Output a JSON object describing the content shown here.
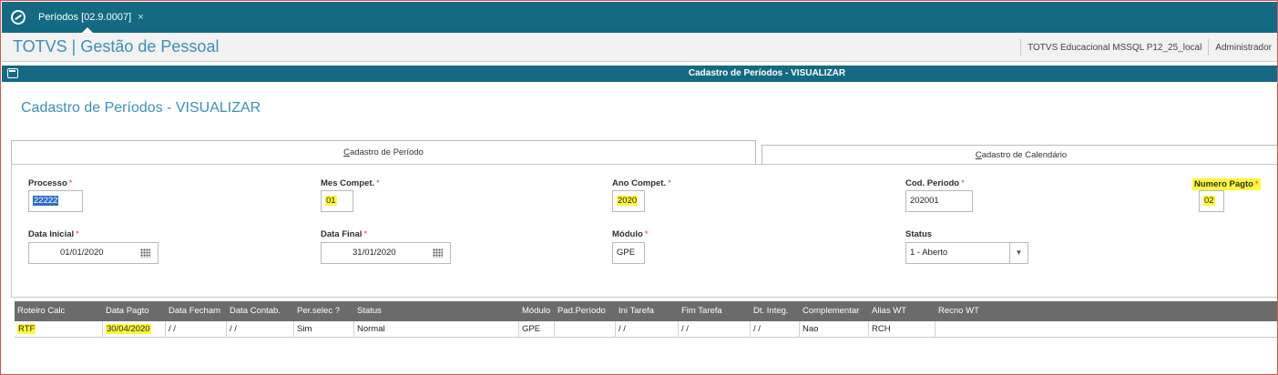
{
  "tabbar": {
    "tab_label": "Períodos [02.9.0007]",
    "close_glyph": "×"
  },
  "header": {
    "title": "TOTVS | Gestão de Pessoal",
    "environment": "TOTVS Educacional MSSQL P12_25_local",
    "user": "Administrador"
  },
  "dialog": {
    "bar_title": "Cadastro de Períodos - VISUALIZAR",
    "heading": "Cadastro de Períodos - VISUALIZAR"
  },
  "folders": {
    "periodo": {
      "first": "C",
      "rest": "adastro de Período"
    },
    "calendario": {
      "first": "C",
      "rest": "adastro de Calendário"
    }
  },
  "form": {
    "processo": {
      "label": "Processo",
      "value": "22222"
    },
    "mes_compet": {
      "label": "Mes Compet.",
      "value": "01"
    },
    "ano_compet": {
      "label": "Ano Compet.",
      "value": "2020"
    },
    "cod_periodo": {
      "label": "Cod. Periodo",
      "value": "202001"
    },
    "numero_pagto": {
      "label": "Numero Pagto",
      "value": "02"
    },
    "data_inicial": {
      "label": "Data Inicial",
      "value": "01/01/2020"
    },
    "data_final": {
      "label": "Data Final",
      "value": "31/01/2020"
    },
    "modulo": {
      "label": "Módulo",
      "value": "GPE"
    },
    "status": {
      "label": "Status",
      "value": "1 - Aberto"
    },
    "required_mark": "*"
  },
  "grid": {
    "columns": [
      "Roteiro Calc",
      "Data Pagto",
      "Data Fecham",
      "Data Contab.",
      "Per.selec ?",
      "Status",
      "Módulo",
      "Pad.Período",
      "Ini Tarefa",
      "Fim Tarefa",
      "Dt. Integ.",
      "Complementar",
      "Alias WT",
      "Recno WT"
    ],
    "rows": [
      [
        "RTF",
        "30/04/2020",
        " / /",
        " / /",
        "Sim",
        "Normal",
        "GPE",
        "",
        " / /",
        " / /",
        " / /",
        "Nao",
        "RCH",
        ""
      ]
    ]
  },
  "colors": {
    "primary": "#136a82",
    "title_blue": "#3d8fb6",
    "highlight": "#fff83b",
    "required": "#e03c3c",
    "grid_header": "#6b6b6b"
  }
}
